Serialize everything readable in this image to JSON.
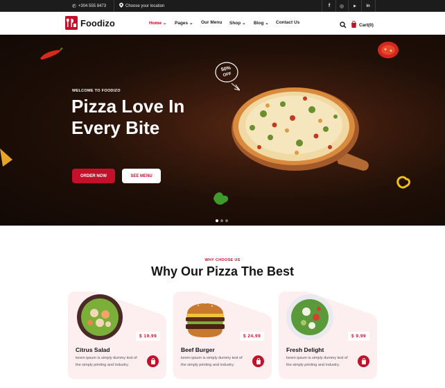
{
  "topbar": {
    "phone": "+304 555 8473",
    "location": "Choose your location",
    "socials": [
      "facebook-icon",
      "instagram-icon",
      "youtube-icon",
      "linkedin-icon"
    ],
    "social_glyphs": [
      "f",
      "◎",
      "▶",
      "in"
    ]
  },
  "nav": {
    "brand": "Foodizo",
    "items": [
      {
        "label": "Home",
        "active": true,
        "caret": "⌄"
      },
      {
        "label": "Pages",
        "active": false,
        "caret": "⌄"
      },
      {
        "label": "Our Menu",
        "active": false,
        "caret": ""
      },
      {
        "label": "Shop",
        "active": false,
        "caret": "⌄"
      },
      {
        "label": "Blog",
        "active": false,
        "caret": "⌄"
      },
      {
        "label": "Contact Us",
        "active": false,
        "caret": ""
      }
    ],
    "cart_label": "Cart(0)"
  },
  "hero": {
    "kicker": "WELCOME TO FOODIZO",
    "title": "Pizza Love In Every Bite",
    "order_button": "ORDER NOW",
    "menu_button": "SEE MENU",
    "badge_line1": "50%",
    "badge_line2": "OFF",
    "slides": 3,
    "active_slide": 1
  },
  "section": {
    "kicker": "WHY CHOOSE US",
    "title": "Why Our Pizza The Best"
  },
  "cards": [
    {
      "name": "Citrus Salad",
      "price": "$ 19.99",
      "desc": "lorem ipsum is simply dummy text of the simply printing and industry."
    },
    {
      "name": "Beef Burger",
      "price": "$ 24.99",
      "desc": "lorem ipsum is simply dummy text of the simply printing and industry."
    },
    {
      "name": "Fresh Delight",
      "price": "$ 9.99",
      "desc": "lorem ipsum is simply dummy text of the simply printing and industry."
    }
  ],
  "colors": {
    "accent": "#c5102b",
    "dark": "#1c1c1c",
    "card_bg": "#fdeef0"
  }
}
